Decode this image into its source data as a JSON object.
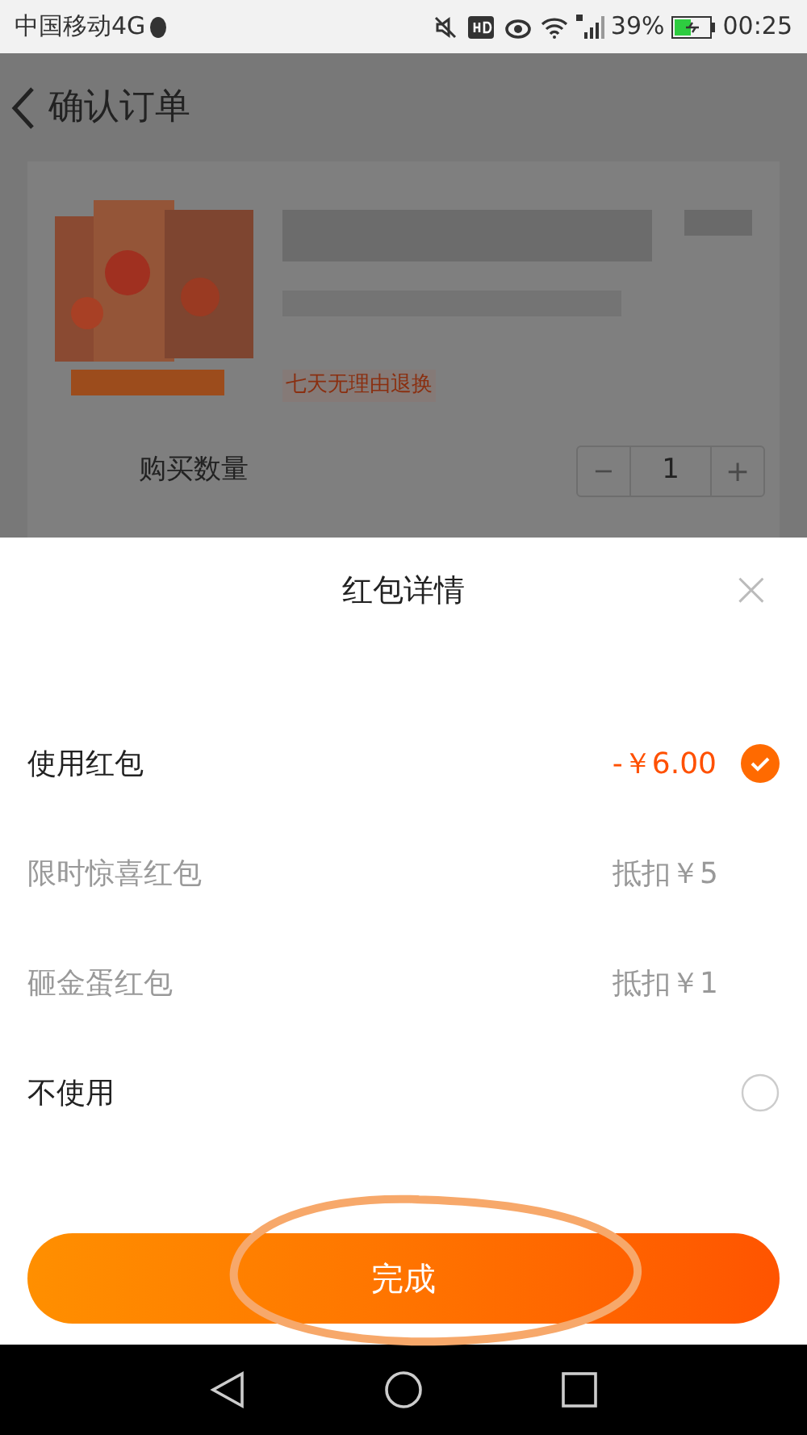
{
  "status_bar": {
    "carrier": "中国移动4G",
    "battery": "39%",
    "time": "00:25"
  },
  "page": {
    "title": "确认订单",
    "product": {
      "kind": "picture",
      "guarantee": "七天无理由退换"
    },
    "quantity": {
      "label": "购买数量",
      "minus": "−",
      "value": "1",
      "plus": "+"
    }
  },
  "sheet": {
    "title": "红包详情",
    "close": "×",
    "rows": [
      {
        "kind": "choice",
        "label": "使用红包",
        "amount": "-￥6.00",
        "selected": true
      },
      {
        "kind": "detail",
        "label": "限时惊喜红包",
        "amount": "抵扣￥5"
      },
      {
        "kind": "detail",
        "label": "砸金蛋红包",
        "amount": "抵扣￥1"
      },
      {
        "kind": "choice",
        "label": "不使用",
        "selected": false
      }
    ],
    "done_button": "完成"
  }
}
